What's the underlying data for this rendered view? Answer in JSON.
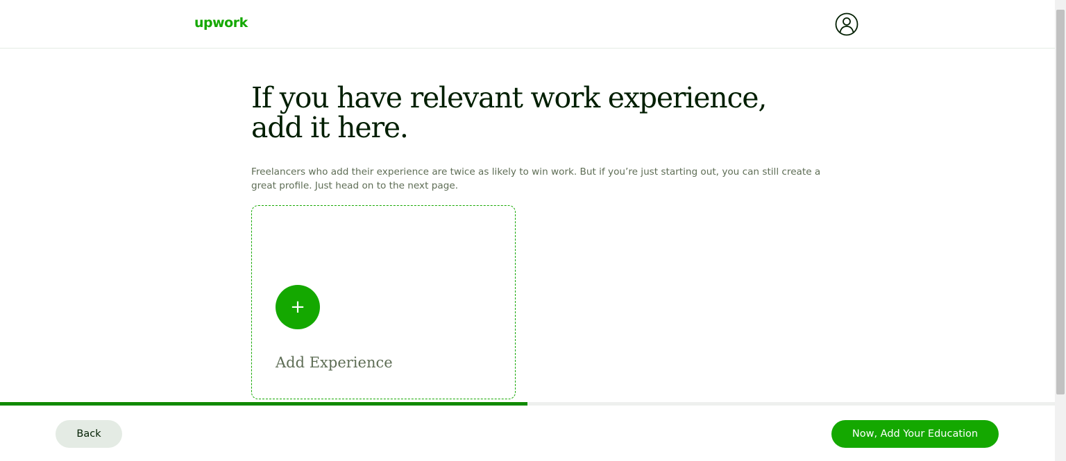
{
  "header": {
    "logo_text": "upwork",
    "avatar_icon": "user-circle-icon"
  },
  "main": {
    "title_line1": "If you have relevant work experience,",
    "title_line2": "add it here.",
    "subtitle": "Freelancers who add their experience are twice as likely to win work. But if you’re just starting out, you can still create a great profile. Just head on to the next page."
  },
  "add_card": {
    "plus_symbol": "+",
    "label": "Add Experience"
  },
  "progress": {
    "fraction": 0.5
  },
  "footer": {
    "back_label": "Back",
    "next_label": "Now, Add Your Education"
  },
  "colors": {
    "brand": "#14a800",
    "text": "#001e00",
    "muted": "#5e6d55"
  }
}
